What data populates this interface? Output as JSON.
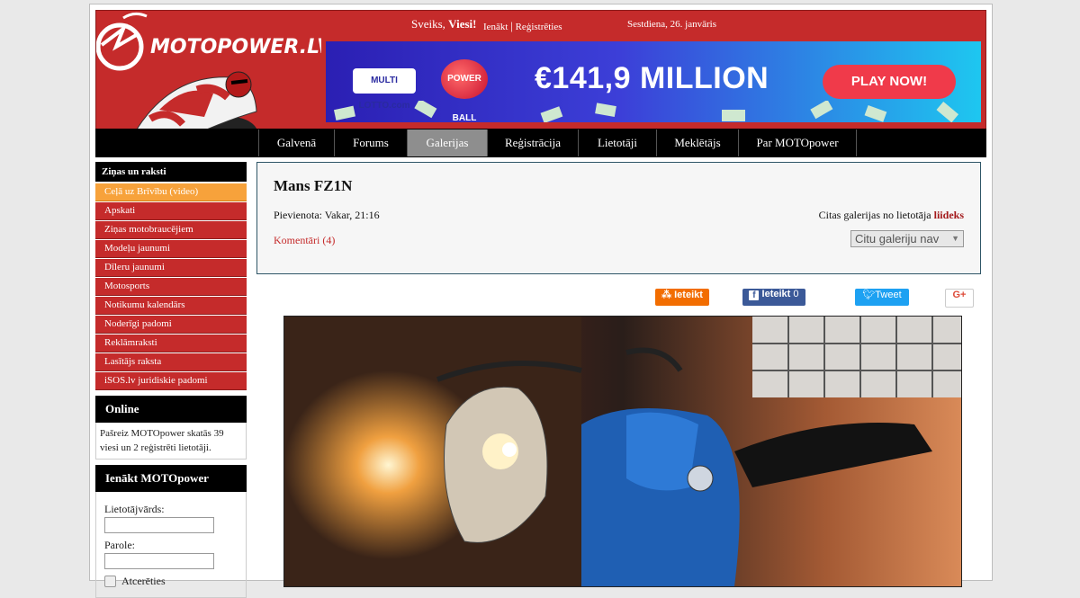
{
  "site": {
    "logo_text": "MOTOPOWER.LV"
  },
  "topbar": {
    "greeting_prefix": "Sveiks,",
    "greeting_name": "Viesi!",
    "login_link": "Ienākt",
    "separator": "|",
    "register_link": "Reģistrēties",
    "date": "Sestdiena, 26. janvāris"
  },
  "banner": {
    "brand1": "MULTI LOTTO.com",
    "brand2": "POWER BALL",
    "amount": "€141,9 MILLION",
    "cta": "PLAY NOW!"
  },
  "nav": [
    "Galvenā",
    "Forums",
    "Galerijas",
    "Reģistrācija",
    "Lietotāji",
    "Meklētājs",
    "Par MOTOpower"
  ],
  "nav_active_index": 2,
  "sidebar": {
    "news_title": "Ziņas un raksti",
    "items": [
      "Ceļā uz Brīvību (video)",
      "Apskati",
      "Ziņas motobraucējiem",
      "Modeļu jaunumi",
      "Dīleru jaunumi",
      "Motosports",
      "Notikumu kalendārs",
      "Noderīgi padomi",
      "Reklāmraksti",
      "Lasītājs raksta",
      "iSOS.lv juridiskie padomi"
    ],
    "highlighted_index": 0,
    "online_title": "Online",
    "online_text": "Pašreiz MOTOpower skatās 39 viesi un 2 reģistrēti lietotāji.",
    "login_title": "Ienākt MOTOpower",
    "username_label": "Lietotājvārds:",
    "password_label": "Parole:",
    "remember_label": "Atcerēties"
  },
  "gallery": {
    "title": "Mans FZ1N",
    "posted": "Pievienota: Vakar, 21:16",
    "comments": "Komentāri (4)",
    "others_prefix": "Citas galerijas no lietotāja",
    "others_user": "liideks",
    "select_value": "Citu galeriju nav"
  },
  "share": {
    "draugiem": "Ieteikt",
    "facebook": "Ieteikt",
    "facebook_count": "0",
    "twitter": "Tweet",
    "gplus": "G+"
  },
  "colors": {
    "brand_red": "#c52b2b",
    "nav_bg": "#000000",
    "highlight": "#f7a23b"
  }
}
